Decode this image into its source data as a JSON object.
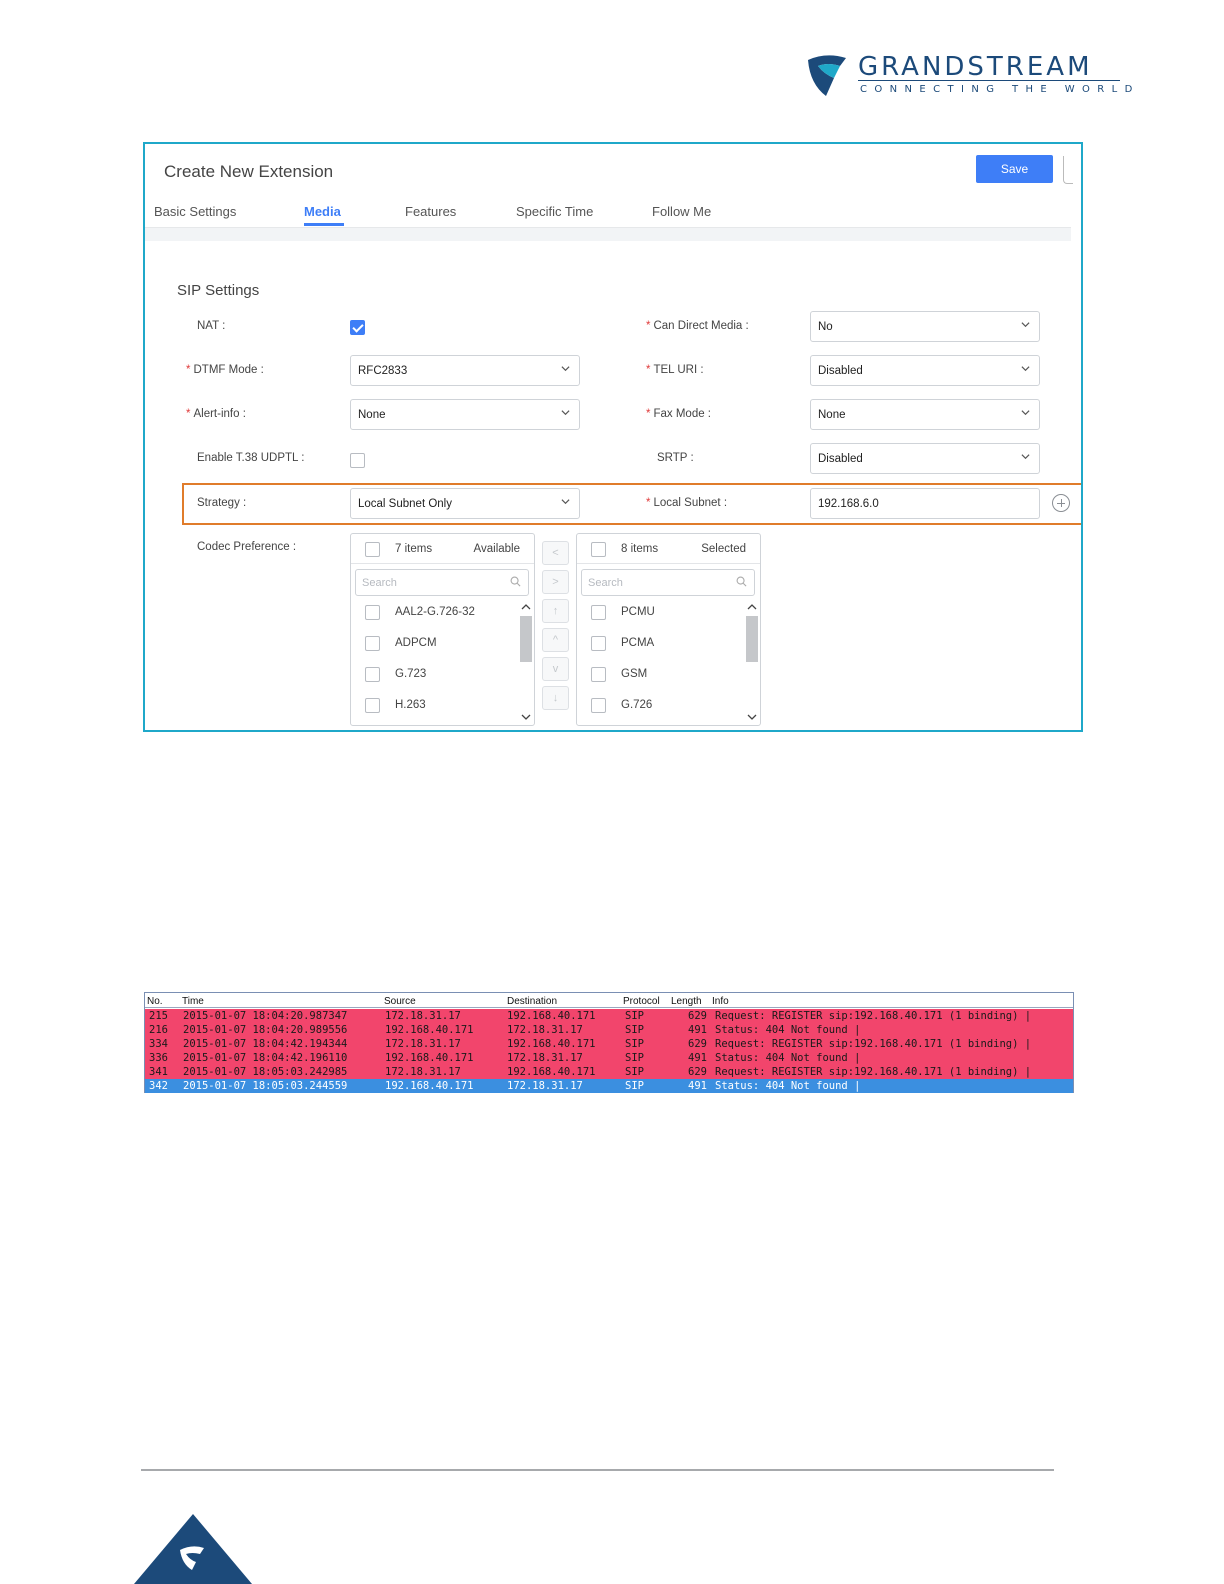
{
  "logo": {
    "brand": "GRANDSTREAM",
    "tagline": "CONNECTING THE WORLD"
  },
  "dialog": {
    "title": "Create New Extension",
    "save_label": "Save",
    "tabs": [
      {
        "label": "Basic Settings",
        "active": false
      },
      {
        "label": "Media",
        "active": true
      },
      {
        "label": "Features",
        "active": false
      },
      {
        "label": "Specific Time",
        "active": false
      },
      {
        "label": "Follow Me",
        "active": false
      }
    ],
    "section_title": "SIP Settings",
    "fields": {
      "nat": {
        "label": "NAT :",
        "checked": true
      },
      "dtmf_mode": {
        "label": "DTMF Mode :",
        "value": "RFC2833",
        "required": true
      },
      "alert_info": {
        "label": "Alert-info :",
        "value": "None",
        "required": true
      },
      "enable_t38": {
        "label": "Enable T.38 UDPTL :",
        "checked": false
      },
      "strategy": {
        "label": "Strategy :",
        "value": "Local Subnet Only"
      },
      "codec_preference": {
        "label": "Codec Preference :"
      },
      "can_direct_media": {
        "label": "Can Direct Media :",
        "value": "No",
        "required": true
      },
      "tel_uri": {
        "label": "TEL URI :",
        "value": "Disabled",
        "required": true
      },
      "fax_mode": {
        "label": "Fax Mode :",
        "value": "None",
        "required": true
      },
      "srtp": {
        "label": "SRTP :",
        "value": "Disabled"
      },
      "local_subnet": {
        "label": "Local Subnet :",
        "value": "192.168.6.0",
        "required": true
      }
    },
    "available": {
      "count": "7 items",
      "title": "Available",
      "search_placeholder": "Search",
      "items": [
        "AAL2-G.726-32",
        "ADPCM",
        "G.723",
        "H.263"
      ]
    },
    "selected": {
      "count": "8 items",
      "title": "Selected",
      "search_placeholder": "Search",
      "items": [
        "PCMU",
        "PCMA",
        "GSM",
        "G.726"
      ]
    },
    "transfer_buttons": [
      "<",
      ">",
      "↑",
      "^",
      "v",
      "↓"
    ]
  },
  "capture": {
    "columns": [
      "No.",
      "Time",
      "Source",
      "Destination",
      "Protocol",
      "Length",
      "Info"
    ],
    "rows": [
      {
        "no": "215",
        "time": "2015-01-07 18:04:20.987347",
        "src": "172.18.31.17",
        "dst": "192.168.40.171",
        "proto": "SIP",
        "len": "629",
        "info": "Request: REGISTER sip:192.168.40.171  (1 binding) |",
        "color": "red"
      },
      {
        "no": "216",
        "time": "2015-01-07 18:04:20.989556",
        "src": "192.168.40.171",
        "dst": "172.18.31.17",
        "proto": "SIP",
        "len": "491",
        "info": "Status: 404 Not found |",
        "color": "red"
      },
      {
        "no": "334",
        "time": "2015-01-07 18:04:42.194344",
        "src": "172.18.31.17",
        "dst": "192.168.40.171",
        "proto": "SIP",
        "len": "629",
        "info": "Request: REGISTER sip:192.168.40.171  (1 binding) |",
        "color": "red"
      },
      {
        "no": "336",
        "time": "2015-01-07 18:04:42.196110",
        "src": "192.168.40.171",
        "dst": "172.18.31.17",
        "proto": "SIP",
        "len": "491",
        "info": "Status: 404 Not found |",
        "color": "red"
      },
      {
        "no": "341",
        "time": "2015-01-07 18:05:03.242985",
        "src": "172.18.31.17",
        "dst": "192.168.40.171",
        "proto": "SIP",
        "len": "629",
        "info": "Request: REGISTER sip:192.168.40.171  (1 binding) |",
        "color": "red"
      },
      {
        "no": "342",
        "time": "2015-01-07 18:05:03.244559",
        "src": "192.168.40.171",
        "dst": "172.18.31.17",
        "proto": "SIP",
        "len": "491",
        "info": "Status: 404 Not found |",
        "color": "blue"
      }
    ]
  },
  "colors": {
    "accent": "#3e7ef7",
    "frame": "#1fa8c9",
    "highlight": "#e07c2b",
    "row_red": "#f2456c",
    "row_blue": "#3b8fe0",
    "brand": "#1c4a7a"
  }
}
